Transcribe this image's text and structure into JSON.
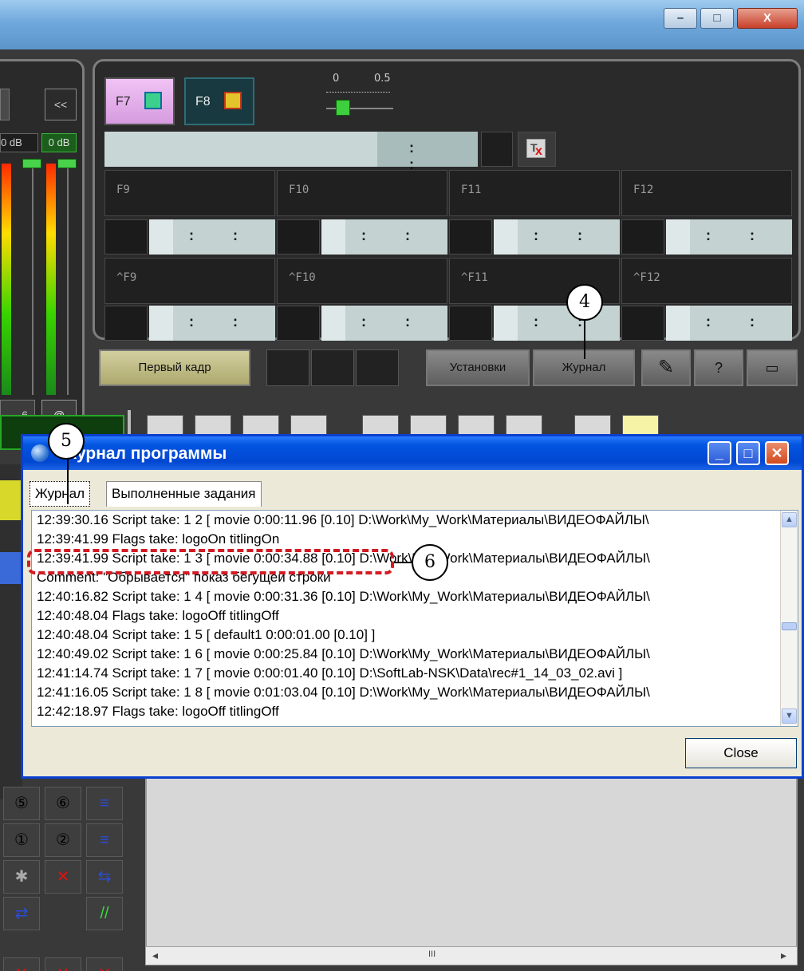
{
  "window": {
    "minimize_glyph": "–",
    "maximize_glyph": "□",
    "close_glyph": "X"
  },
  "top_panel": {
    "f7_label": "F7",
    "f8_label": "F8",
    "slider_ticks": [
      "0",
      "0.5"
    ],
    "timecode_colon": ":   :",
    "slots": [
      {
        "key": "F9"
      },
      {
        "key": "F10"
      },
      {
        "key": "F11"
      },
      {
        "key": "F12"
      },
      {
        "key": "^F9"
      },
      {
        "key": "^F10"
      },
      {
        "key": "^F11"
      },
      {
        "key": "^F12"
      }
    ],
    "mini_timecode": ":   :"
  },
  "left_panel": {
    "collapse_label": "<<",
    "db_left": "0 dB",
    "db_right": "0 dB",
    "bottom_num": "6",
    "at_label": "@"
  },
  "toolbar": {
    "first_frame": "Первый кадр",
    "settings": "Установки",
    "journal": "Журнал"
  },
  "dialog": {
    "title": "Журнал программы",
    "tabs": [
      "Журнал",
      "Выполненные задания"
    ],
    "log_lines": [
      "12:39:30.16  Script take: 1 2 [ movie 0:00:11.96 [0.10] D:\\Work\\My_Work\\Материалы\\ВИДЕОФАЙЛЫ\\",
      "12:39:41.99  Flags take:  logoOn titlingOn",
      "12:39:41.99  Script take: 1 3 [ movie 0:00:34.88 [0.10] D:\\Work\\My_Work\\Материалы\\ВИДЕОФАЙЛЫ\\",
      "Comment: \"Обрывается\" показ бегущей строки",
      "12:40:16.82  Script take: 1 4 [ movie 0:00:31.36 [0.10] D:\\Work\\My_Work\\Материалы\\ВИДЕОФАЙЛЫ\\",
      "12:40:48.04  Flags take:  logoOff titlingOff",
      "12:40:48.04  Script take: 1 5 [ default1 0:00:01.00 [0.10] ]",
      "12:40:49.02  Script take: 1 6 [ movie 0:00:25.84 [0.10] D:\\Work\\My_Work\\Материалы\\ВИДЕОФАЙЛЫ\\",
      "12:41:14.74  Script take: 1 7 [ movie 0:00:01.40 [0.10] D:\\SoftLab-NSK\\Data\\rec#1_14_03_02.avi ]",
      "12:41:16.05  Script take: 1 8 [ movie 0:01:03.04 [0.10] D:\\Work\\My_Work\\Материалы\\ВИДЕОФАЙЛЫ\\",
      "12:42:18.97  Flags take:  logoOff titlingOff"
    ],
    "close_label": "Close"
  },
  "callouts": {
    "c4": "4",
    "c5": "5",
    "c6": "6"
  },
  "bottom_scroll": {
    "thumb_glyph": "III"
  },
  "colors": {
    "dialog_title": "#0047d1",
    "highlight_dash": "#d31b24",
    "f7_pink": "#e2a8ea",
    "f8_teal": "#18393f"
  }
}
